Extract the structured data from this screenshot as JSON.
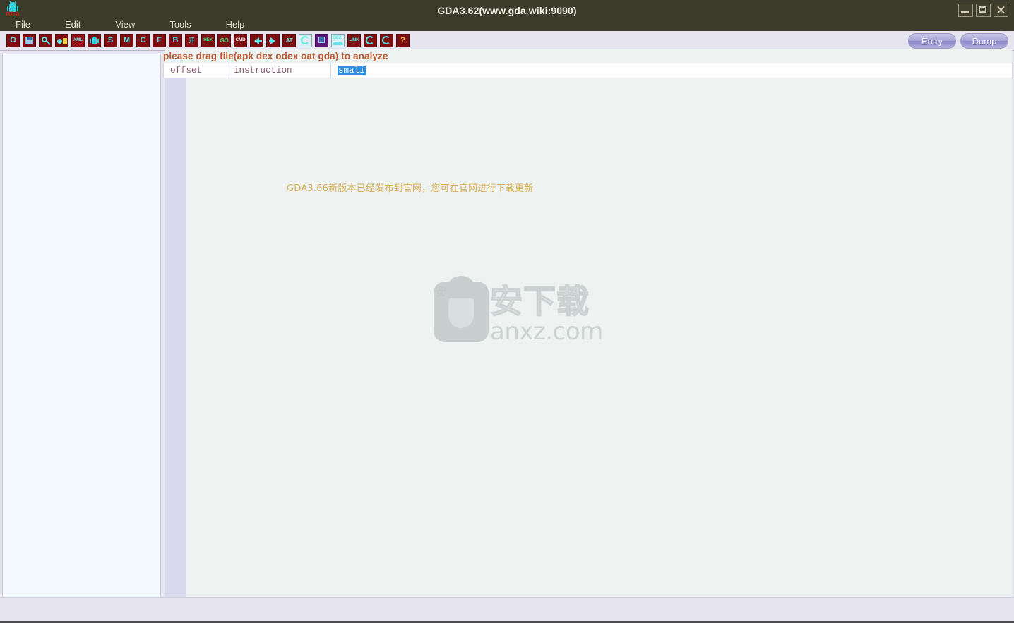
{
  "window": {
    "title": "GDA3.62(www.gda.wiki:9090)",
    "app_icon": "android-robot-icon",
    "app_icon_label": "GDA",
    "controls": {
      "minimize": "minimize-icon",
      "maximize": "maximize-icon",
      "close": "close-icon"
    }
  },
  "menubar": {
    "items": [
      {
        "label": "File"
      },
      {
        "label": "Edit"
      },
      {
        "label": "View"
      },
      {
        "label": "Tools"
      },
      {
        "label": "Help"
      }
    ]
  },
  "toolbar": {
    "icons": [
      {
        "name": "open-file-icon",
        "glyph": "O",
        "style": ""
      },
      {
        "name": "save-icon",
        "glyph": "",
        "style": "save"
      },
      {
        "name": "search-icon",
        "glyph": "",
        "style": "magnifier"
      },
      {
        "name": "toggle-view-icon",
        "glyph": "",
        "style": "pill"
      },
      {
        "name": "xml-viewer-icon",
        "glyph": "XML",
        "style": "checker micro"
      },
      {
        "name": "android-manifest-icon",
        "glyph": "",
        "style": "droid"
      },
      {
        "name": "string-list-icon",
        "glyph": "S",
        "style": ""
      },
      {
        "name": "method-list-icon",
        "glyph": "M",
        "style": ""
      },
      {
        "name": "class-list-icon",
        "glyph": "C",
        "style": ""
      },
      {
        "name": "field-list-icon",
        "glyph": "F",
        "style": ""
      },
      {
        "name": "bytecode-icon",
        "glyph": "B",
        "style": ""
      },
      {
        "name": "tree-structure-icon",
        "glyph": "开",
        "style": ""
      },
      {
        "name": "hex-view-icon",
        "glyph": "HEX",
        "style": "green micro"
      },
      {
        "name": "goto-icon",
        "glyph": "GO",
        "style": "green tiny"
      },
      {
        "name": "command-icon",
        "glyph": "CMD",
        "style": "white micro"
      },
      {
        "name": "back-arrow-icon",
        "glyph": "",
        "style": "arrow-left"
      },
      {
        "name": "forward-arrow-icon",
        "glyph": "",
        "style": "arrow-right"
      },
      {
        "name": "at-icon",
        "glyph": "AT",
        "style": "tiny"
      },
      {
        "name": "debug-icon",
        "glyph": "",
        "style": "pale"
      },
      {
        "name": "notes-icon",
        "glyph": "",
        "style": "purple"
      },
      {
        "name": "dex-icon",
        "glyph": "DEX",
        "style": "pale micro"
      },
      {
        "name": "link-icon",
        "glyph": "LINK",
        "style": "micro"
      },
      {
        "name": "refresh-icon",
        "glyph": "",
        "style": "reload1"
      },
      {
        "name": "undo-icon",
        "glyph": "",
        "style": "reload2"
      },
      {
        "name": "help-icon",
        "glyph": "?",
        "style": "yellow"
      }
    ],
    "entry_label": "Entry",
    "dump_label": "Dump"
  },
  "main": {
    "drag_hint": "please drag file(apk dex odex oat gda) to analyze",
    "columns": [
      {
        "label": "offset",
        "selected": false
      },
      {
        "label": "instruction",
        "selected": false
      },
      {
        "label": "smali",
        "selected": true
      }
    ],
    "notice": "GDA3.66新版本已经发布到官网，您可在官网进行下载更新"
  },
  "watermark": {
    "shield_char": "安",
    "cn_text": "安下载",
    "en_text": "anxz.com"
  },
  "colors": {
    "titlebar": "#3d3c2c",
    "toolbar": "#e6e5ef",
    "icon_red": "#7d0e12",
    "icon_cyan": "#57e8e8",
    "hint_orange": "#bb5a33",
    "notice_gold": "#d8ae52",
    "selection_blue": "#2f8fe0",
    "gutter": "#d9d8ec",
    "editor_bg": "#eef3f1",
    "tree_bg": "#f4f9fd"
  }
}
